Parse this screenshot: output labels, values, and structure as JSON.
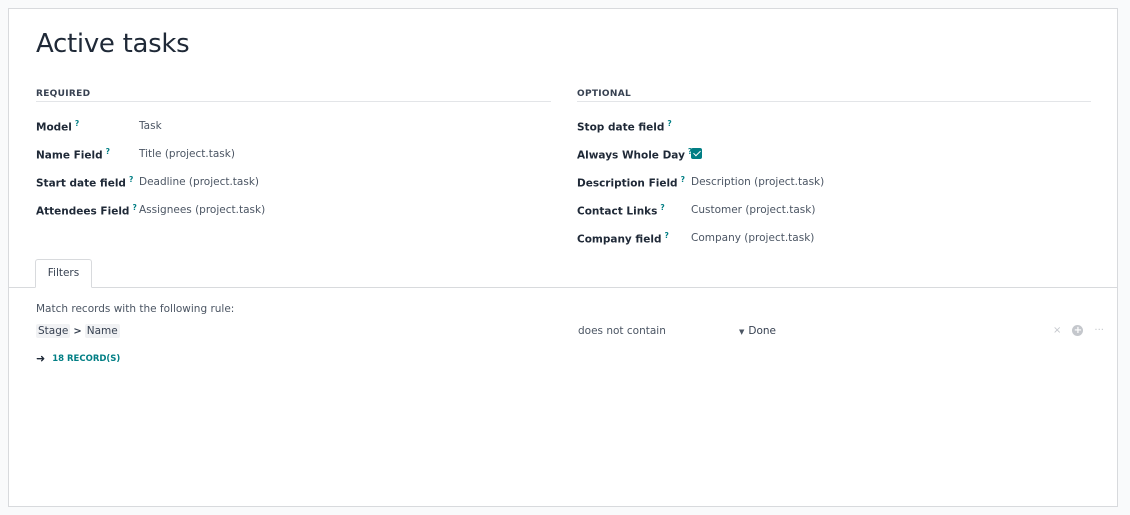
{
  "page": {
    "title": "Active tasks"
  },
  "required": {
    "heading": "REQUIRED",
    "fields": [
      {
        "label": "Model",
        "value": "Task"
      },
      {
        "label": "Name Field",
        "value": "Title (project.task)"
      },
      {
        "label": "Start date field",
        "value": "Deadline (project.task)"
      },
      {
        "label": "Attendees Field",
        "value": "Assignees (project.task)"
      }
    ]
  },
  "optional": {
    "heading": "OPTIONAL",
    "fields": [
      {
        "label": "Stop date field",
        "value": ""
      },
      {
        "label": "Always Whole Day",
        "checked": true
      },
      {
        "label": "Description Field",
        "value": "Description (project.task)"
      },
      {
        "label": "Contact Links",
        "value": "Customer (project.task)"
      },
      {
        "label": "Company field",
        "value": "Company (project.task)"
      }
    ]
  },
  "help_marker": "?",
  "tabs": [
    {
      "label": "Filters",
      "active": true
    }
  ],
  "filters": {
    "intro": "Match records with the following rule:",
    "rule": {
      "path": [
        "Stage",
        "Name"
      ],
      "path_separator": ">",
      "operator": "does not contain",
      "value": "Done"
    },
    "actions": {
      "remove": "×",
      "add": "+",
      "more": "···"
    },
    "records_label": "18 RECORD(S)"
  },
  "colors": {
    "accent": "#017e84",
    "text": "#374151",
    "border": "#d8dadd"
  }
}
